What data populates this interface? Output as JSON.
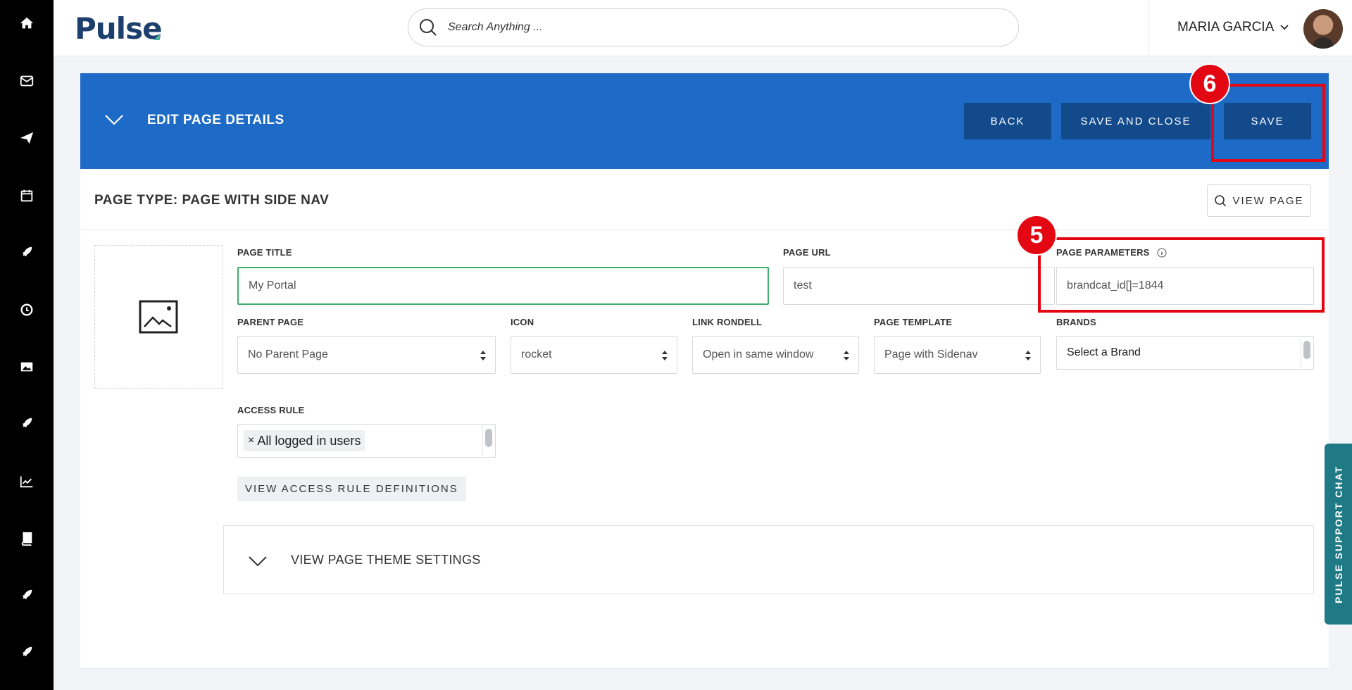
{
  "rail": {
    "items": [
      {
        "icon": "home-icon"
      },
      {
        "icon": "mail-icon"
      },
      {
        "icon": "paper-plane-icon"
      },
      {
        "icon": "calendar-icon"
      },
      {
        "icon": "rocket-icon"
      },
      {
        "icon": "clock-icon"
      },
      {
        "icon": "image-icon"
      },
      {
        "icon": "rocket-icon"
      },
      {
        "icon": "chart-icon"
      },
      {
        "icon": "book-icon"
      },
      {
        "icon": "rocket-icon"
      },
      {
        "icon": "rocket-icon"
      }
    ]
  },
  "header": {
    "logo": "Pulse",
    "search_placeholder": "Search Anything ...",
    "user_name": "MARIA GARCIA"
  },
  "edit": {
    "title": "EDIT PAGE DETAILS",
    "back_label": "BACK",
    "save_close_label": "SAVE AND CLOSE",
    "save_label": "SAVE"
  },
  "annotations": {
    "save_marker": "6",
    "params_marker": "5",
    "color": "#e30613"
  },
  "panel": {
    "page_type": "PAGE TYPE: PAGE WITH SIDE NAV",
    "view_page_label": "VIEW PAGE",
    "fields": {
      "page_title": {
        "label": "PAGE TITLE",
        "value": "My Portal"
      },
      "page_url": {
        "label": "PAGE URL",
        "value": "test"
      },
      "page_parameters": {
        "label": "PAGE PARAMETERS",
        "value": "brandcat_id[]=1844"
      },
      "parent_page": {
        "label": "PARENT PAGE",
        "value": "No Parent Page"
      },
      "icon": {
        "label": "ICON",
        "value": "rocket"
      },
      "link_rondell": {
        "label": "LINK RONDELL",
        "value": "Open in same window"
      },
      "page_template": {
        "label": "PAGE TEMPLATE",
        "value": "Page with Sidenav"
      },
      "brands": {
        "label": "BRANDS",
        "placeholder": "Select a Brand"
      },
      "access_rule": {
        "label": "ACCESS RULE",
        "tags": [
          "All logged in users"
        ]
      }
    },
    "access_rule_button": "VIEW ACCESS RULE DEFINITIONS",
    "theme_settings_label": "VIEW PAGE THEME SETTINGS"
  },
  "support_chat": {
    "label": "PULSE SUPPORT CHAT"
  },
  "colors": {
    "header_blue": "#1d6ac7",
    "button_navy": "#124a8c",
    "support_teal": "#1f7a86",
    "active_green": "#3fae6b"
  }
}
